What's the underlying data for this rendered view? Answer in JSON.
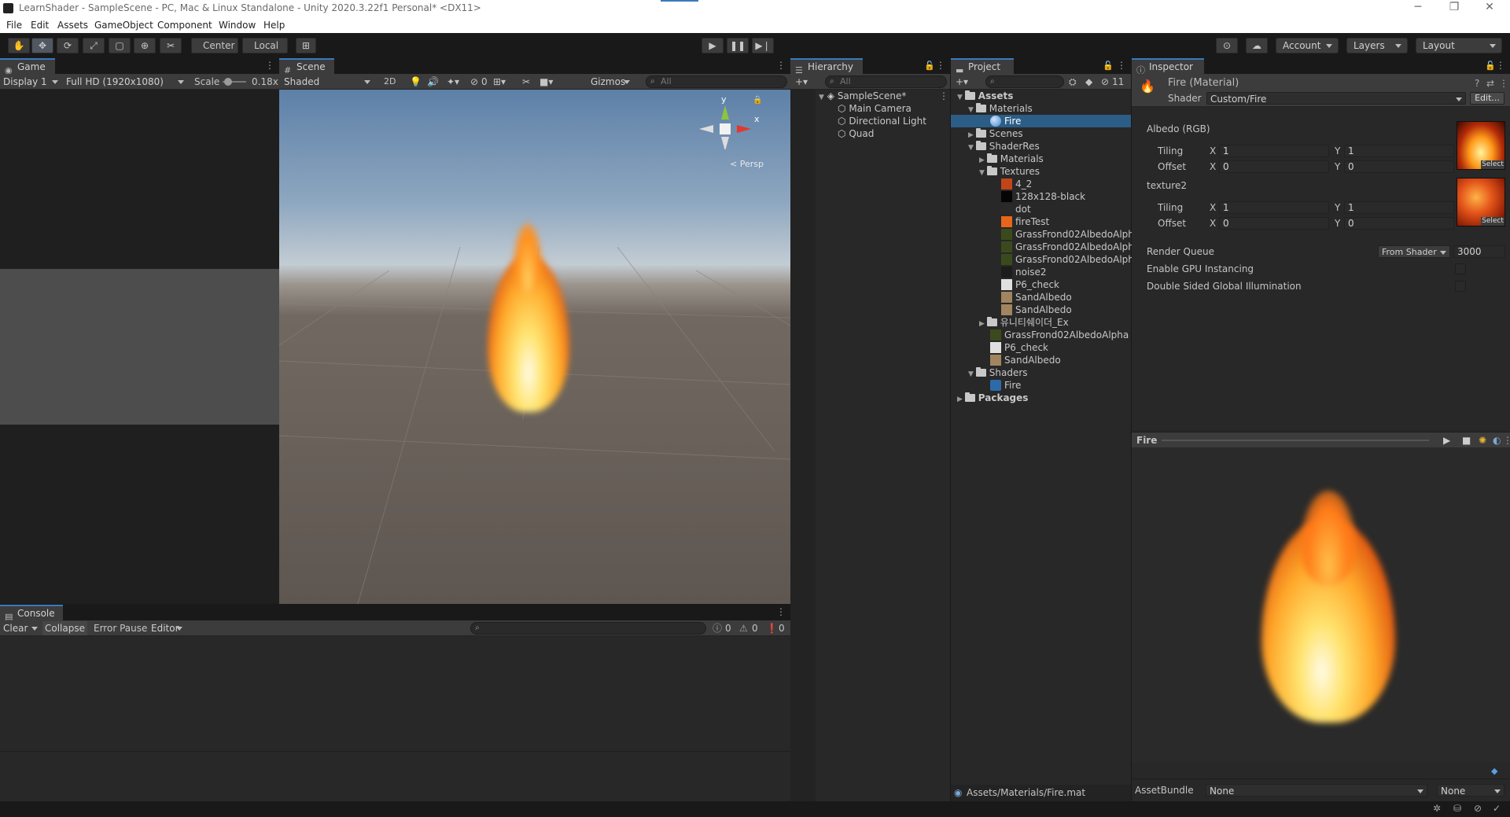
{
  "window": {
    "title": "LearnShader - SampleScene - PC, Mac & Linux Standalone - Unity 2020.3.22f1 Personal* <DX11>"
  },
  "menu": [
    "File",
    "Edit",
    "Assets",
    "GameObject",
    "Component",
    "Window",
    "Help"
  ],
  "toolbar": {
    "pivot_label": "Center",
    "space_label": "Local",
    "account_label": "Account",
    "layers_label": "Layers",
    "layout_label": "Layout"
  },
  "game": {
    "tab": "Game",
    "display": "Display 1",
    "resolution": "Full HD (1920x1080)",
    "scale_label": "Scale",
    "scale_value": "0.18x"
  },
  "scene": {
    "tab": "Scene",
    "shading": "Shaded",
    "mode_2d": "2D",
    "hidden_count": "0",
    "gizmos": "Gizmos",
    "search_placeholder": "All",
    "persp_label": "< Persp",
    "axis_y": "y",
    "axis_x": "x"
  },
  "hierarchy": {
    "tab": "Hierarchy",
    "search_placeholder": "All",
    "scene_name": "SampleScene*",
    "items": [
      "Main Camera",
      "Directional Light",
      "Quad"
    ]
  },
  "project": {
    "tab": "Project",
    "hidden_count": "11",
    "footer_path": "Assets/Materials/Fire.mat",
    "tree": [
      {
        "label": "Assets",
        "depth": 0,
        "kind": "folder",
        "open": true,
        "bold": true
      },
      {
        "label": "Materials",
        "depth": 1,
        "kind": "folder",
        "open": true
      },
      {
        "label": "Fire",
        "depth": 2,
        "kind": "material",
        "selected": true
      },
      {
        "label": "Scenes",
        "depth": 1,
        "kind": "folder",
        "open": false
      },
      {
        "label": "ShaderRes",
        "depth": 1,
        "kind": "folder",
        "open": true
      },
      {
        "label": "Materials",
        "depth": 2,
        "kind": "folder",
        "open": false
      },
      {
        "label": "Textures",
        "depth": 2,
        "kind": "folder",
        "open": true
      },
      {
        "label": "4_2",
        "depth": 3,
        "kind": "tex",
        "color": "#c2451a"
      },
      {
        "label": "128x128-black",
        "depth": 3,
        "kind": "tex",
        "color": "#050505"
      },
      {
        "label": "dot",
        "depth": 3,
        "kind": "tex",
        "color": "#2a2a2a"
      },
      {
        "label": "fireTest",
        "depth": 3,
        "kind": "tex",
        "color": "#e8661a"
      },
      {
        "label": "GrassFrond02AlbedoAlpha",
        "depth": 3,
        "kind": "tex",
        "color": "#3b4a1c"
      },
      {
        "label": "GrassFrond02AlbedoAlpha",
        "depth": 3,
        "kind": "tex",
        "color": "#3b4a1c"
      },
      {
        "label": "GrassFrond02AlbedoAlpha",
        "depth": 3,
        "kind": "tex",
        "color": "#3b4a1c"
      },
      {
        "label": "noise2",
        "depth": 3,
        "kind": "tex",
        "color": "#1c1c1c"
      },
      {
        "label": "P6_check",
        "depth": 3,
        "kind": "tex",
        "color": "#e0e0e0"
      },
      {
        "label": "SandAlbedo",
        "depth": 3,
        "kind": "tex",
        "color": "#a08560"
      },
      {
        "label": "SandAlbedo",
        "depth": 3,
        "kind": "tex",
        "color": "#a08560"
      },
      {
        "label": "유니티쉐이더_Ex",
        "depth": 2,
        "kind": "folder",
        "open": false
      },
      {
        "label": "GrassFrond02AlbedoAlpha",
        "depth": 2,
        "kind": "tex",
        "color": "#3b4a1c"
      },
      {
        "label": "P6_check",
        "depth": 2,
        "kind": "tex",
        "color": "#e0e0e0"
      },
      {
        "label": "SandAlbedo",
        "depth": 2,
        "kind": "tex",
        "color": "#a08560"
      },
      {
        "label": "Shaders",
        "depth": 1,
        "kind": "folder",
        "open": true
      },
      {
        "label": "Fire",
        "depth": 2,
        "kind": "shader"
      },
      {
        "label": "Packages",
        "depth": 0,
        "kind": "folder",
        "open": false,
        "bold": true
      }
    ]
  },
  "inspector": {
    "tab": "Inspector",
    "material_title": "Fire (Material)",
    "shader_label": "Shader",
    "shader_value": "Custom/Fire",
    "edit_label": "Edit...",
    "albedo_label": "Albedo (RGB)",
    "texture2_label": "texture2",
    "tiling_label": "Tiling",
    "offset_label": "Offset",
    "x_label": "X",
    "y_label": "Y",
    "albedo_tiling_x": "1",
    "albedo_tiling_y": "1",
    "albedo_offset_x": "0",
    "albedo_offset_y": "0",
    "tex2_tiling_x": "1",
    "tex2_tiling_y": "1",
    "tex2_offset_x": "0",
    "tex2_offset_y": "0",
    "select_label": "Select",
    "render_queue_label": "Render Queue",
    "render_queue_mode": "From Shader",
    "render_queue_value": "3000",
    "gpu_instancing_label": "Enable GPU Instancing",
    "double_sided_gi_label": "Double Sided Global Illumination",
    "preview_title": "Fire",
    "assetbundle_label": "AssetBundle",
    "assetbundle_value": "None",
    "assetbundle_variant": "None"
  },
  "console": {
    "tab": "Console",
    "clear_label": "Clear",
    "collapse_label": "Collapse",
    "error_pause_label": "Error Pause",
    "editor_label": "Editor",
    "info_count": "0",
    "warn_count": "0",
    "error_count": "0"
  },
  "colors": {
    "selection": "#2c5d87",
    "tab_accent": "#3a79bb"
  }
}
